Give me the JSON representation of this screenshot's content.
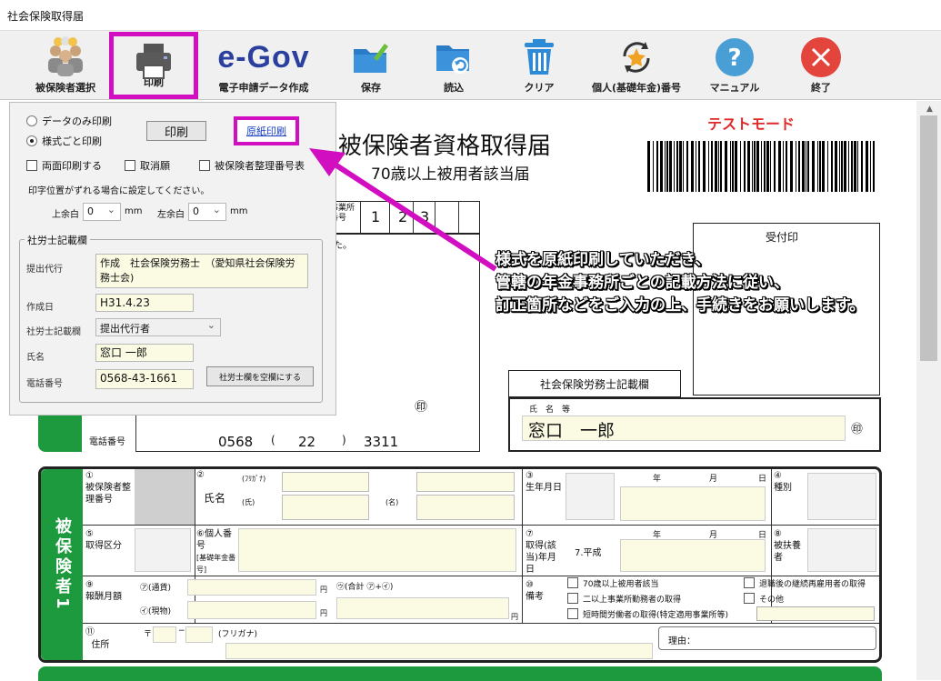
{
  "window": {
    "title": "社会保険取得届"
  },
  "toolbar": {
    "items": [
      {
        "id": "insured",
        "label": "被保険者選択",
        "icon": "people-icon"
      },
      {
        "id": "print",
        "label": "印刷",
        "icon": "printer-icon"
      },
      {
        "id": "egov",
        "label": "電子申請データ作成",
        "logo": "e-Gov"
      },
      {
        "id": "save",
        "label": "保存",
        "icon": "folder-save-icon"
      },
      {
        "id": "load",
        "label": "読込",
        "icon": "folder-load-icon"
      },
      {
        "id": "clear",
        "label": "クリア",
        "icon": "trash-icon"
      },
      {
        "id": "pension",
        "label": "個人(基礎年金)番号",
        "icon": "star-refresh-icon"
      },
      {
        "id": "manual",
        "label": "マニュアル",
        "icon": "help-icon"
      },
      {
        "id": "exit",
        "label": "終了",
        "icon": "close-icon"
      }
    ]
  },
  "print_panel": {
    "radio_data_only": "データのみ印刷",
    "radio_with_form": "様式ごと印刷",
    "print_button": "印刷",
    "original_print_link": "原紙印刷",
    "duplex": "両面印刷する",
    "cancel_request": "取消願",
    "insured_number": "被保険者整理番号表",
    "offset_note": "印字位置がずれる場合に設定してください。",
    "top_margin_label": "上余白",
    "top_margin_value": "0",
    "left_margin_label": "左余白",
    "left_margin_value": "0",
    "unit": "mm",
    "sharoushi": {
      "legend": "社労士記載欄",
      "agent_label": "提出代行",
      "agent_value": "作成　社会保険労務士　（愛知県社会保険労務士会)",
      "date_label": "作成日",
      "date_value": "H31.4.23",
      "column_label": "社労士記載欄",
      "column_value": "提出代行者",
      "name_label": "氏名",
      "name_value": "窓口 一郎",
      "phone_label": "電話番号",
      "phone_value": "0568-43-1661",
      "blank_button": "社労士欄を空欄にする"
    }
  },
  "callout": {
    "lines": [
      "様式を原紙印刷していただき、",
      "管轄の年金事務所ごとの記載方法に従い、",
      "訂正箇所などをご入力の上、手続きをお願いします。"
    ],
    "color": "#d10fc0"
  },
  "form": {
    "title": "被保険者資格取得届",
    "subtitle": "70歳以上被用者該当届",
    "test_mode": "テストモード",
    "office_code_label": "事業所\n番号",
    "office_code": [
      "1",
      "2",
      "3"
    ],
    "receipt_label": "受付印",
    "sharoushi_box_label": "社会保険労務士記載欄",
    "name_sublabel": "氏　名　等",
    "name_value": "窓口　一郎",
    "seal": "㊞",
    "phone_label": "電話番号",
    "phone_parts": [
      "0568",
      "(",
      "22",
      ")",
      "3311"
    ],
    "fragment_text": "た。",
    "rows": {
      "band": "被保険者1",
      "r1": {
        "no": "①",
        "label": "被保険者整理番号",
        "name_no": "②",
        "name_label": "氏名",
        "furigana": "(ﾌﾘｶﾞﾅ)",
        "sei": "(氏)",
        "mei": "(名)",
        "birth_no": "③",
        "birth_label": "生年月日",
        "year": "年",
        "month": "月",
        "day": "日",
        "gender_no": "④",
        "gender_label": "種別"
      },
      "r2": {
        "no": "⑤",
        "label": "取得区分",
        "personal_no": "⑥",
        "personal_label": "個人番号",
        "basic_label": "[基礎年金番号]",
        "acq_no": "⑦",
        "acq_label": "取得(該当)年月日",
        "era": "7.平成",
        "year": "年",
        "month": "月",
        "day": "日",
        "dep_no": "⑧",
        "dep_label": "被扶養者"
      },
      "r3": {
        "no": "⑨",
        "label": "報酬月額",
        "currency": "㋐(通貨)",
        "kind": "㋑(現物)",
        "total": "㋒(合計 ㋐+㋑)",
        "yen": "円",
        "note_no": "⑩",
        "note_label": "備考",
        "opt1": "70歳以上被用者該当",
        "opt2": "二以上事業所勤務者の取得",
        "opt3": "短時間労働者の取得(特定適用事業所等)",
        "opt4": "退職後の継続再雇用者の取得",
        "opt5": "その他"
      },
      "r4": {
        "no": "⑪",
        "label": "住所",
        "postal": "〒",
        "dash": "−",
        "furigana": "(フリガナ)",
        "reason": "理由："
      }
    }
  }
}
